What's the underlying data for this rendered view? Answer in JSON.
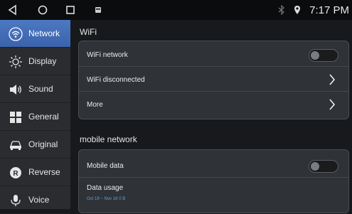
{
  "statusbar": {
    "time": "7:17 PM"
  },
  "sidebar": {
    "items": [
      {
        "label": "Network",
        "icon": "wifi-icon"
      },
      {
        "label": "Display",
        "icon": "brightness-icon"
      },
      {
        "label": "Sound",
        "icon": "speaker-icon"
      },
      {
        "label": "General",
        "icon": "grid-icon"
      },
      {
        "label": "Original",
        "icon": "car-icon"
      },
      {
        "label": "Reverse",
        "icon": "reverse-icon"
      },
      {
        "label": "Voice",
        "icon": "microphone-icon"
      }
    ],
    "active_index": 0
  },
  "wifi": {
    "title": "WiFi",
    "network_label": "WiFi network",
    "status_label": "WiFi disconnected",
    "more_label": "More"
  },
  "mobile": {
    "title": "mobile network",
    "data_label": "Mobile data",
    "usage_label": "Data usage",
    "usage_sub": "Oct 19 ~ Nov 16 0 B"
  },
  "colors": {
    "accent": "#4d78c2",
    "link": "#5fa0e0"
  }
}
